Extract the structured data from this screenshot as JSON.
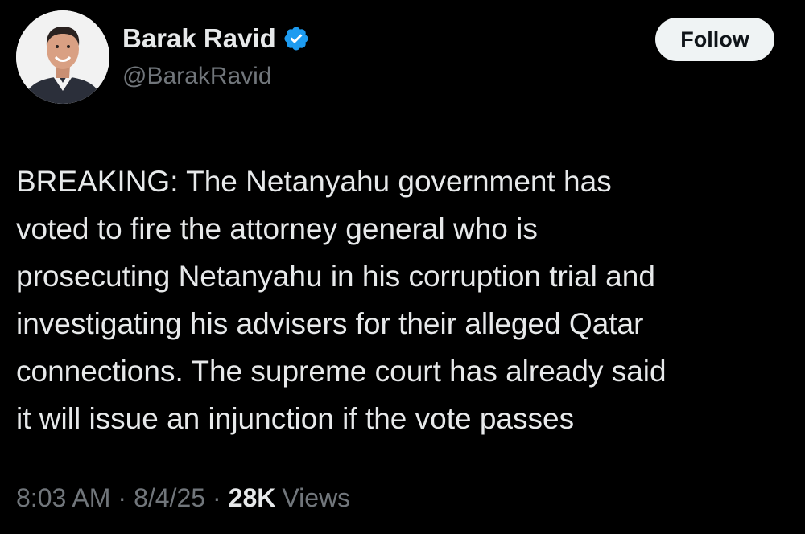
{
  "author": {
    "display_name": "Barak Ravid",
    "handle": "@BarakRavid",
    "verified": true,
    "verified_color": "#1d9bf0"
  },
  "follow_button": {
    "label": "Follow"
  },
  "tweet": {
    "lines": [
      "BREAKING: The Netanyahu government has",
      "voted to fire the attorney general who is",
      "prosecuting Netanyahu in his corruption trial and",
      "investigating his advisers for their alleged Qatar",
      "connections. The supreme court has already said",
      "it will issue an injunction if the vote passes"
    ]
  },
  "meta": {
    "time": "8:03 AM",
    "separator": "·",
    "date": "8/4/25",
    "views_count": "28K",
    "views_label": "Views"
  },
  "colors": {
    "background": "#000000",
    "primary_text": "#e7e9ea",
    "secondary_text": "#71767b",
    "button_bg": "#eff3f4"
  }
}
